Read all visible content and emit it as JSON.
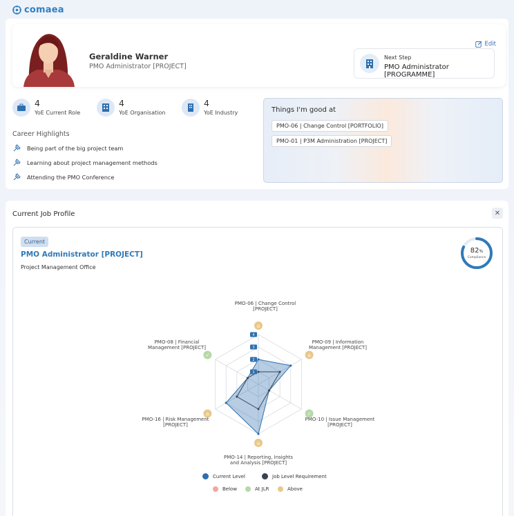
{
  "app": {
    "logo_text": "comaea"
  },
  "profile": {
    "name": "Geraldine Warner",
    "role": "PMO Administrator [PROJECT]",
    "edit_label": "Edit",
    "next_step_label": "Next Step",
    "next_step_value": "PMO Administrator [PROGRAMME]"
  },
  "stats": [
    {
      "value": "4",
      "label": "YoE Current Role",
      "icon": "briefcase-icon"
    },
    {
      "value": "4",
      "label": "YoE Organisation",
      "icon": "building-icon"
    },
    {
      "value": "4",
      "label": "YoE Industry",
      "icon": "office-icon"
    }
  ],
  "career": {
    "title": "Career Highlights",
    "items": [
      "Being part of the big project team",
      "Learning about project management methods",
      "Attending the PMO Conference"
    ]
  },
  "good_at": {
    "title": "Things I'm good at",
    "skills": [
      "PMO-06 | Change Control [PORTFOLIO]",
      "PMO-01 | P3M Administration [PROJECT]"
    ]
  },
  "job_profile": {
    "section_title": "Current Job Profile",
    "badge": "Current",
    "title": "PMO Administrator [PROJECT]",
    "department": "Project Management Office",
    "compliance_value": "82",
    "compliance_unit": "%",
    "compliance_label": "Compliance",
    "compliance_fraction": 0.82
  },
  "radar": {
    "axes": [
      {
        "name": "PMO-06 | Change Control",
        "sub": "[PROJECT]",
        "status": "above"
      },
      {
        "name": "PMO-09 | Information",
        "sub": "Management [PROJECT]",
        "status": "above"
      },
      {
        "name": "PMO-10 | Issue Management",
        "sub": "[PROJECT]",
        "status": "at"
      },
      {
        "name": "PMO-14 | Reporting, Insights",
        "sub": "and Analysis [PROJECT]",
        "status": "above"
      },
      {
        "name": "PMO-16 | Risk Management",
        "sub": "[PROJECT]",
        "status": "above"
      },
      {
        "name": "PMO-08 | Financial",
        "sub": "Management [PROJECT]",
        "status": "at"
      }
    ],
    "levels": [
      "1",
      "2",
      "3",
      "4"
    ],
    "current": [
      2,
      3,
      1,
      4,
      3,
      1
    ],
    "requirement": [
      1,
      2,
      1,
      2,
      2,
      1
    ],
    "legend": {
      "current": "Current Level",
      "requirement": "Job Level Requirement",
      "below": "Below",
      "at": "At JLR",
      "above": "Above"
    },
    "colors": {
      "current": "#2f6fae",
      "requirement": "#3a4250",
      "below": "#f0a8a0",
      "at": "#b6d9a8",
      "above": "#e9c88a"
    }
  }
}
